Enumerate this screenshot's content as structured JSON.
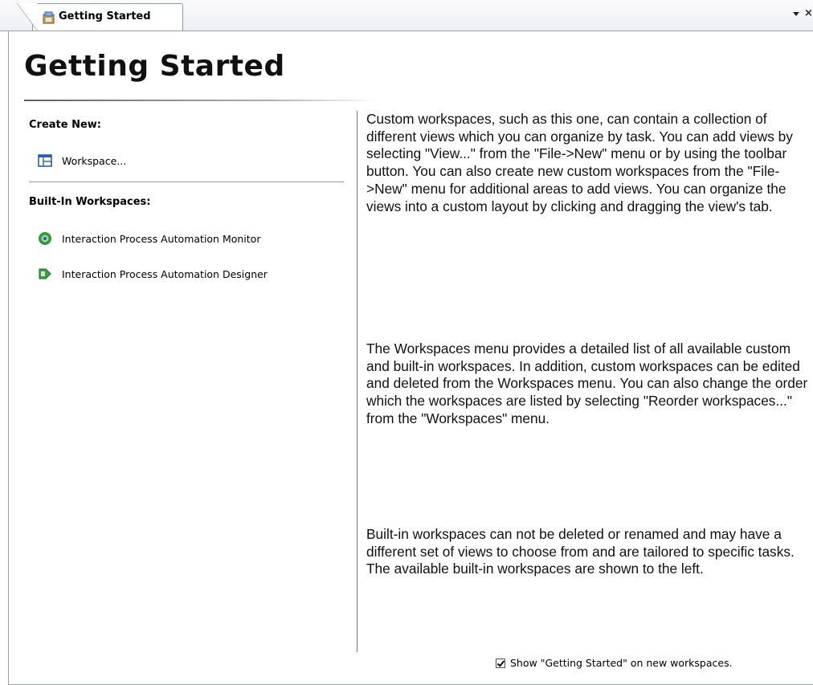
{
  "tab": {
    "label": "Getting Started",
    "icon": "getting-started-icon"
  },
  "page": {
    "title": "Getting Started"
  },
  "create_new": {
    "heading": "Create New:",
    "items": [
      {
        "label": "Workspace...",
        "icon": "workspace-icon"
      }
    ]
  },
  "builtin": {
    "heading": "Built-In Workspaces:",
    "items": [
      {
        "label": "Interaction Process Automation Monitor",
        "icon": "monitor-icon"
      },
      {
        "label": "Interaction Process Automation Designer",
        "icon": "designer-icon"
      }
    ]
  },
  "description": {
    "paragraphs": [
      "Custom workspaces, such as this one, can contain a collection of different views which you can organize by task. You can add views by selecting \"View...\" from the \"File->New\" menu or by using the toolbar button. You can also create new custom workspaces from the \"File->New\" menu for additional areas to add views. You can organize the views into a custom layout by clicking and dragging the view's tab.",
      "The Workspaces menu provides a detailed list of all available custom and built-in workspaces. In addition, custom workspaces can be edited and deleted from the Workspaces menu. You can also change the order which the workspaces are listed by selecting \"Reorder workspaces...\" from the \"Workspaces\" menu.",
      "Built-in workspaces can not be deleted or renamed and may have a different set of views to choose from and are tailored to specific tasks. The available built-in workspaces are shown to the left."
    ]
  },
  "footer": {
    "checkbox_label": "Show \"Getting Started\" on new workspaces.",
    "checked": true
  },
  "colors": {
    "monitor_icon": "#2e9a3a",
    "designer_icon": "#3aa040",
    "workspace_icon": "#2a5fa8"
  }
}
